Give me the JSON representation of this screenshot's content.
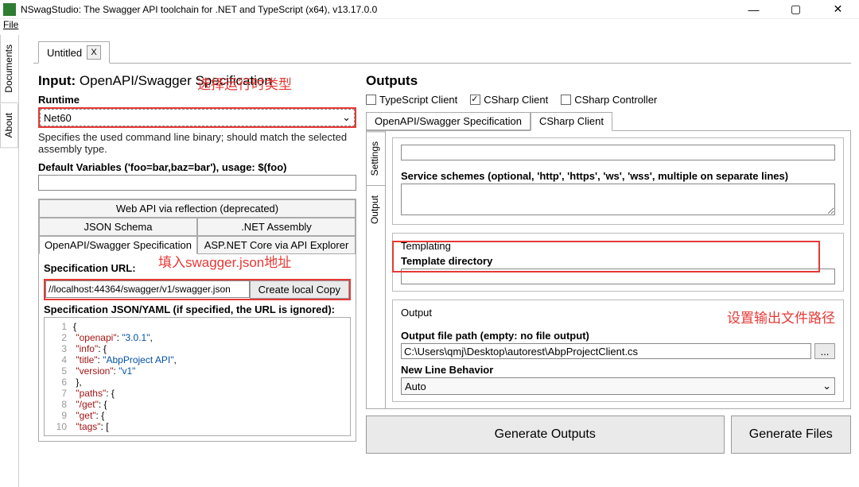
{
  "window": {
    "title": "NSwagStudio: The Swagger API toolchain for .NET and TypeScript (x64), v13.17.0.0",
    "menu_file": "File"
  },
  "sidebar": {
    "about": "About",
    "documents": "Documents"
  },
  "doc_tab": {
    "label": "Untitled",
    "close": "X"
  },
  "input": {
    "title_prefix": "Input:",
    "title_rest": " OpenAPI/Swagger Specification",
    "annotation1": "选择运行时类型",
    "runtime_label": "Runtime",
    "runtime_value": "Net60",
    "runtime_help": "Specifies the used command line binary; should match the selected assembly type.",
    "default_vars_label": "Default Variables ('foo=bar,baz=bar'), usage: $(foo)",
    "tabs": {
      "reflection": "Web API via reflection (deprecated)",
      "json_schema": "JSON Schema",
      "net_assembly": ".NET Assembly",
      "openapi_spec": "OpenAPI/Swagger Specification",
      "aspnet_core": "ASP.NET Core via API Explorer"
    },
    "annotation2": "填入swagger.json地址",
    "spec_url_label": "Specification URL:",
    "spec_url_value": "//localhost:44364/swagger/v1/swagger.json",
    "create_copy_btn": "Create local Copy",
    "spec_json_label": "Specification JSON/YAML (if specified, the URL is ignored):"
  },
  "json_lines": [
    {
      "n": 1,
      "t": "{"
    },
    {
      "n": 2,
      "t": "  \"openapi\": \"3.0.1\","
    },
    {
      "n": 3,
      "t": "  \"info\": {"
    },
    {
      "n": 4,
      "t": "    \"title\": \"AbpProject API\","
    },
    {
      "n": 5,
      "t": "    \"version\": \"v1\""
    },
    {
      "n": 6,
      "t": "  },"
    },
    {
      "n": 7,
      "t": "  \"paths\": {"
    },
    {
      "n": 8,
      "t": "    \"/get\": {"
    },
    {
      "n": 9,
      "t": "      \"get\": {"
    },
    {
      "n": 10,
      "t": "        \"tags\": ["
    }
  ],
  "outputs": {
    "title": "Outputs",
    "ts_client": "TypeScript Client",
    "cs_client": "CSharp Client",
    "cs_controller": "CSharp Controller",
    "tab_openapi": "OpenAPI/Swagger Specification",
    "tab_csclient": "CSharp Client",
    "vtab_settings": "Settings",
    "vtab_output": "Output",
    "schemes_label": "Service schemes (optional, 'http', 'https', 'ws', 'wss', multiple on separate lines)",
    "templating_header": "Templating",
    "template_dir_label": "Template directory",
    "output_header": "Output",
    "annotation3": "设置输出文件路径",
    "file_path_label": "Output file path (empty: no file output)",
    "file_path_value": "C:\\Users\\qmj\\Desktop\\autorest\\AbpProjectClient.cs",
    "browse_btn": "...",
    "newline_label": "New Line Behavior",
    "newline_value": "Auto",
    "gen_outputs_btn": "Generate Outputs",
    "gen_files_btn": "Generate Files"
  }
}
